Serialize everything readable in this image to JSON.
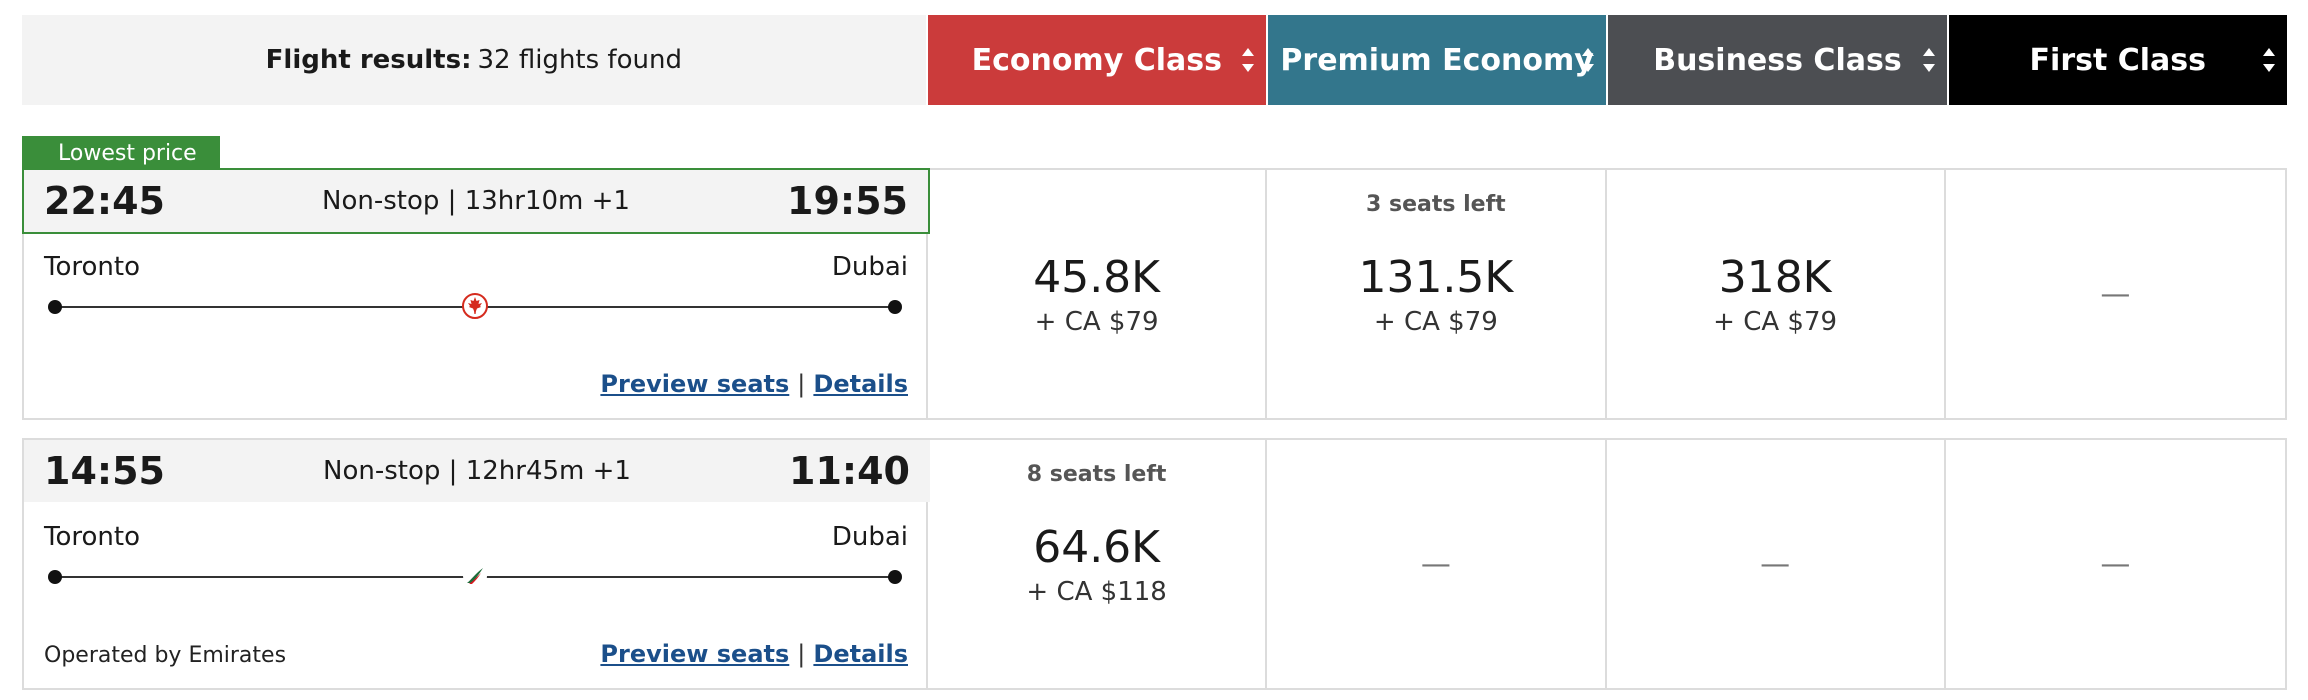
{
  "header": {
    "results_label": "Flight results:",
    "results_count": "32 flights found",
    "classes": [
      {
        "label": "Economy Class",
        "color": "#cb3b3b"
      },
      {
        "label": "Premium Economy",
        "color": "#33768c"
      },
      {
        "label": "Business Class",
        "color": "#4c4e52"
      },
      {
        "label": "First Class",
        "color": "#000000"
      }
    ]
  },
  "badge": "Lowest price",
  "flights": [
    {
      "depart": "22:45",
      "duration": "Non-stop | 13hr10m +1",
      "arrive": "19:55",
      "origin": "Toronto",
      "destination": "Dubai",
      "airline_icon": "air-canada-maple-leaf-icon",
      "preview_link": "Preview seats",
      "details_link": "Details",
      "separator": "|",
      "prices": [
        {
          "seats": "",
          "points": "45.8K",
          "fee": "+ CA $79"
        },
        {
          "seats": "3 seats left",
          "points": "131.5K",
          "fee": "+ CA $79"
        },
        {
          "seats": "",
          "points": "318K",
          "fee": "+ CA $79"
        },
        {
          "dash": "—"
        }
      ]
    },
    {
      "depart": "14:55",
      "duration": "Non-stop | 12hr45m +1",
      "arrive": "11:40",
      "origin": "Toronto",
      "destination": "Dubai",
      "airline_icon": "emirates-icon",
      "operated_by": "Operated by Emirates",
      "preview_link": "Preview seats",
      "details_link": "Details",
      "separator": "|",
      "prices": [
        {
          "seats": "8 seats left",
          "points": "64.6K",
          "fee": "+ CA $118"
        },
        {
          "dash": "—"
        },
        {
          "dash": "—"
        },
        {
          "dash": "—"
        }
      ]
    }
  ]
}
